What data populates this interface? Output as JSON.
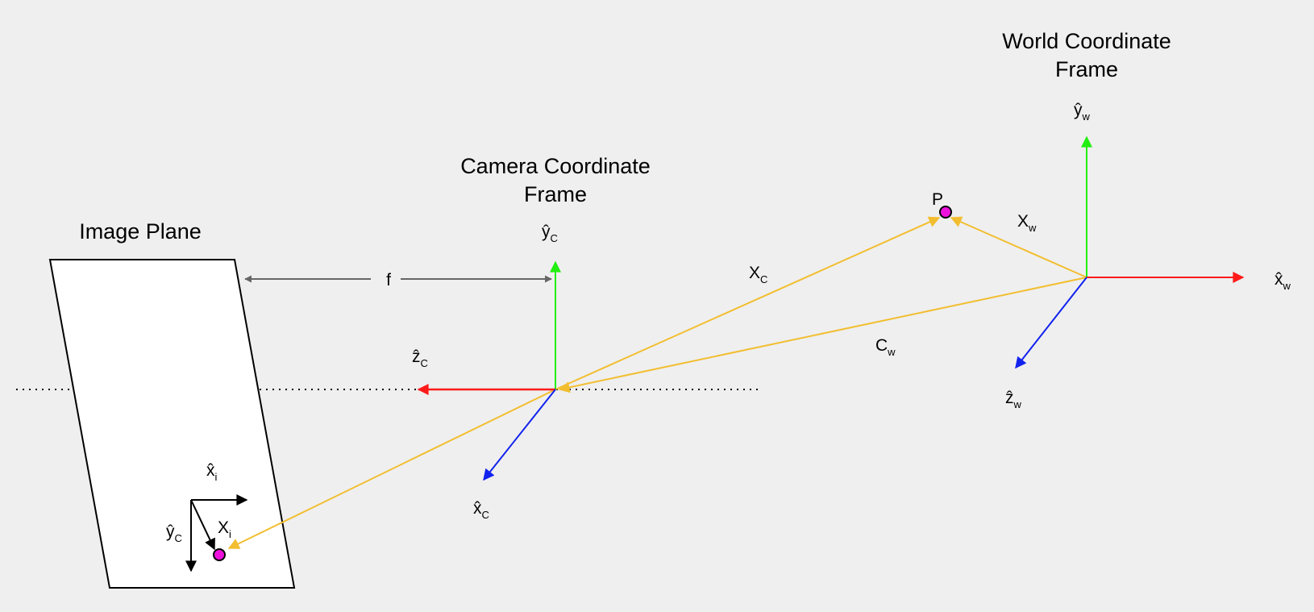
{
  "colors": {
    "background": "#efefef",
    "x_axis_red": "#ff1a1a",
    "y_axis_green": "#22ee11",
    "z_axis_blue": "#1122ee",
    "vector_orange": "#f2be30",
    "focal_gray": "#666666",
    "point_magenta": "#ee11dd"
  },
  "titles": {
    "image_plane": "Image Plane",
    "camera_frame_line1": "Camera Coordinate",
    "camera_frame_line2": "Frame",
    "world_frame_line1": "World Coordinate",
    "world_frame_line2": "Frame"
  },
  "labels": {
    "focal_length": "f",
    "point_p": "P",
    "x_c_vec": {
      "main": "X",
      "sub": "C"
    },
    "x_w_vec": {
      "main": "X",
      "sub": "w"
    },
    "c_w_vec": {
      "main": "C",
      "sub": "w"
    },
    "x_i_vec": {
      "main": "X",
      "sub": "i"
    },
    "cam_y_axis": {
      "main": "ŷ",
      "sub": "C"
    },
    "cam_z_axis": {
      "main": "ẑ",
      "sub": "C"
    },
    "cam_x_axis": {
      "main": "x̂",
      "sub": "C"
    },
    "world_y_axis": {
      "main": "ŷ",
      "sub": "w"
    },
    "world_x_axis": {
      "main": "x̂",
      "sub": "w"
    },
    "world_z_axis": {
      "main": "ẑ",
      "sub": "w"
    },
    "img_x_axis": {
      "main": "x̂",
      "sub": "i"
    },
    "img_y_axis": {
      "main": "ŷ",
      "sub": "C"
    }
  },
  "icons": {
    "point": "filled-circle",
    "arrowhead": "triangle"
  }
}
